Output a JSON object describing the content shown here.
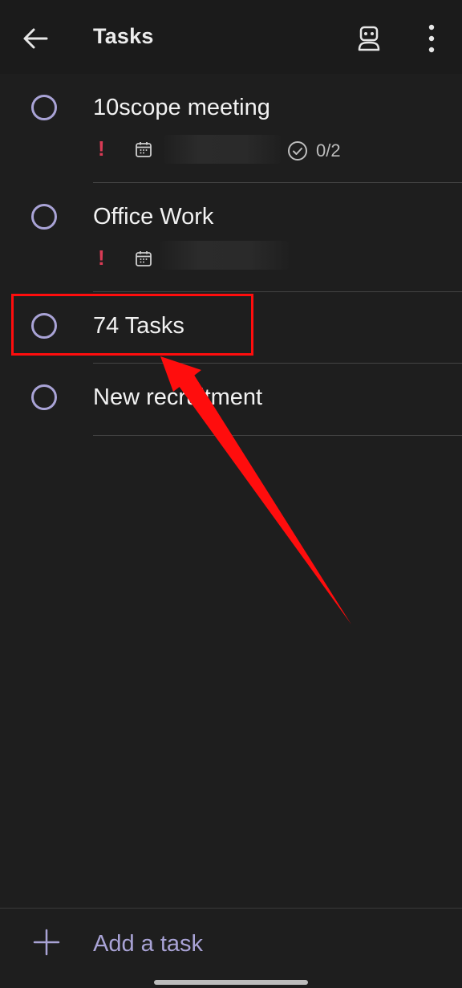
{
  "header": {
    "title": "Tasks",
    "back_icon": "arrow-left-icon",
    "assistant_icon": "robot-icon",
    "more_icon": "more-vertical-icon"
  },
  "tasks": [
    {
      "name": "10scope meeting",
      "important": "!",
      "steps": "0/2"
    },
    {
      "name": "Office Work",
      "important": "!"
    },
    {
      "name": "74 Tasks"
    },
    {
      "name": "New recruitment"
    }
  ],
  "footer": {
    "add_label": "Add a task"
  },
  "colors": {
    "background": "#1e1e1e",
    "accent": "#a9a3d6",
    "important": "#d93b55",
    "annotation": "#ff0d0d"
  }
}
